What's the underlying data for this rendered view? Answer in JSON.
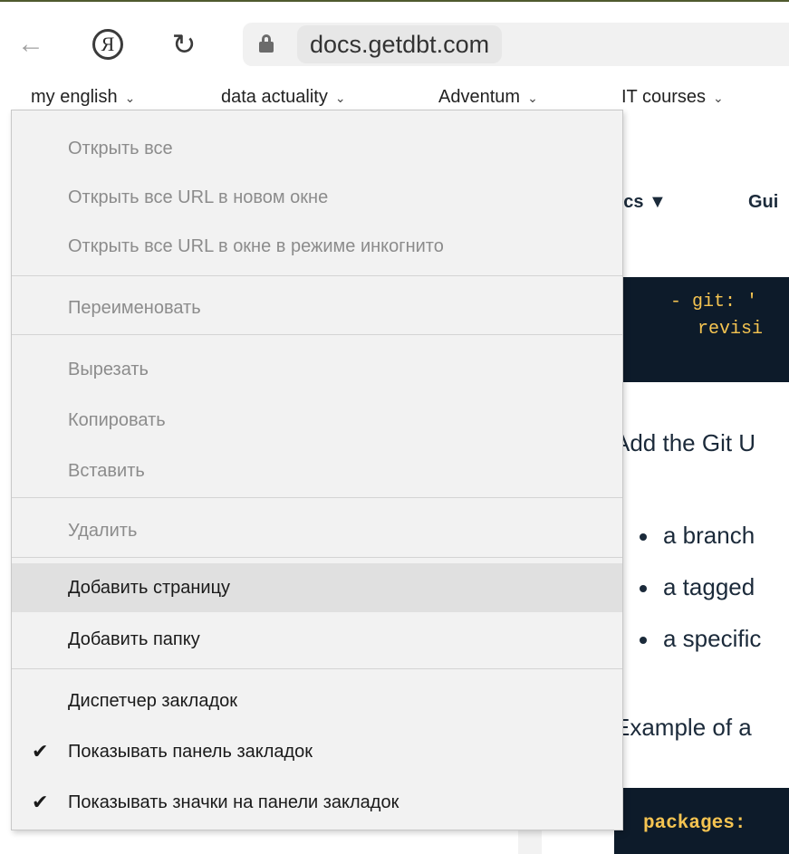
{
  "browser": {
    "url": "docs.getdbt.com",
    "back_glyph": "←",
    "yandex_glyph": "Я",
    "reload_glyph": "↻"
  },
  "bookmarks_bar": [
    {
      "label": "my english"
    },
    {
      "label": "data actuality"
    },
    {
      "label": "Adventum"
    },
    {
      "label": "IT courses"
    }
  ],
  "chevron_glyph": "⌄",
  "page": {
    "nav_docs": "ocs ▼",
    "nav_guides": "Gui",
    "code1_line1": "- git: '",
    "code1_line2": "revisi",
    "para1": "Add the Git U",
    "bullets": [
      "a branch",
      "a tagged",
      "a specific"
    ],
    "para2": "Example of a",
    "code2_line1": "packages:"
  },
  "context_menu": {
    "open_all": "Открыть все",
    "open_all_new_window": "Открыть все URL в новом окне",
    "open_all_incognito": "Открыть все URL в окне в режиме инкогнито",
    "rename": "Переименовать",
    "cut": "Вырезать",
    "copy": "Копировать",
    "paste": "Вставить",
    "delete": "Удалить",
    "add_page": "Добавить страницу",
    "add_folder": "Добавить папку",
    "bookmark_manager": "Диспетчер закладок",
    "show_bookmarks_bar": "Показывать панель закладок",
    "show_bookmarks_bar_icons": "Показывать значки на панели закладок",
    "check_glyph": "✔"
  }
}
